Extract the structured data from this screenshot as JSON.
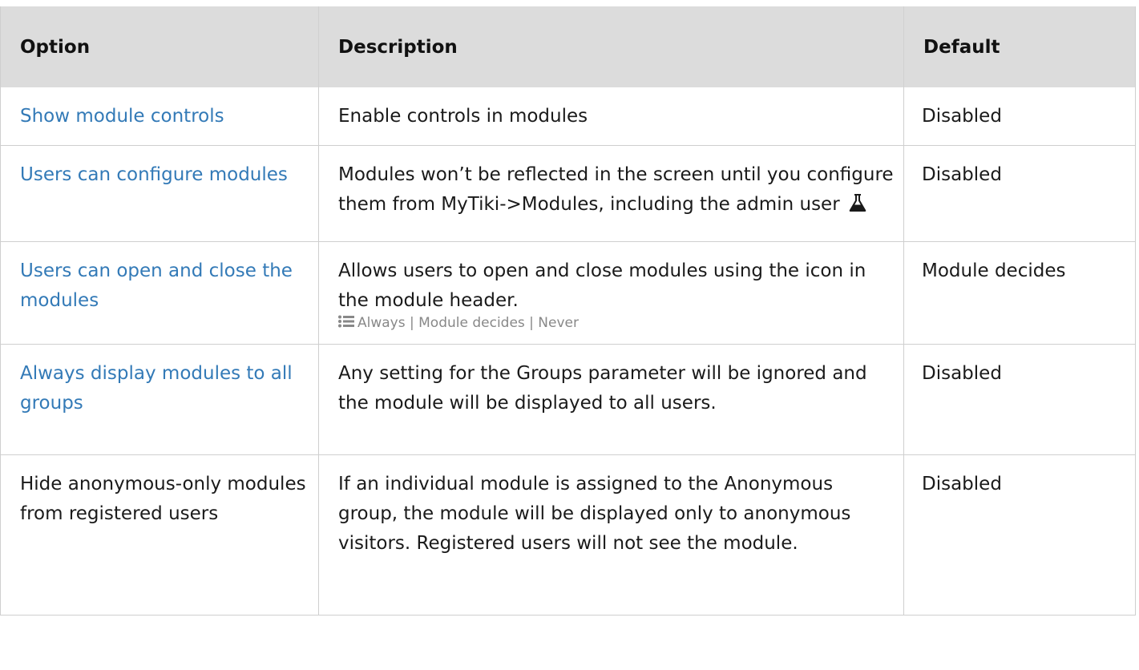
{
  "table": {
    "headers": {
      "option": "Option",
      "description": "Description",
      "default": "Default"
    },
    "rows": [
      {
        "option": "Show module controls",
        "option_is_link": true,
        "description": "Enable controls in modules",
        "default": "Disabled"
      },
      {
        "option": "Users can configure modules",
        "option_is_link": true,
        "description": "Modules won’t be reflected in the screen until you configure them from MyTiki->Modules, including the admin user",
        "description_icon": "flask-icon",
        "default": "Disabled"
      },
      {
        "option": "Users can open and close the modules",
        "option_is_link": true,
        "description": "Allows users to open and close modules using the icon in the module header.",
        "choices_icon": "list-icon",
        "choices": "Always | Module decides | Never",
        "default": "Module decides"
      },
      {
        "option": "Always display modules to all groups",
        "option_is_link": true,
        "description": "Any setting for the Groups parameter will be ignored and the module will be displayed to all users.",
        "default": "Disabled"
      },
      {
        "option": "Hide anonymous-only modules from registered users",
        "option_is_link": false,
        "description": "If an individual module is assigned to the Anonymous group, the module will be displayed only to anonymous visitors. Registered users will not see the module.",
        "default": "Disabled"
      }
    ]
  },
  "colors": {
    "header_bg": "#dcdcdc",
    "link": "#337ab7",
    "muted": "#888888",
    "border": "#cfcfcf"
  }
}
